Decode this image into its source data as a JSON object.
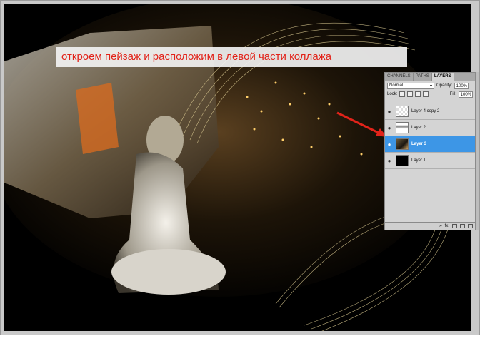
{
  "caption": "откроем пейзаж и расположим в левой части коллажа",
  "panel": {
    "tabs": [
      "CHANNELS",
      "PATHS",
      "LAYERS"
    ],
    "blend_mode": "Normal",
    "opacity_label": "Opacity:",
    "opacity_value": "100%",
    "lock_label": "Lock:",
    "fill_label": "Fill:",
    "fill_value": "100%",
    "layers": [
      {
        "name": "Layer 4 copy 2",
        "selected": false
      },
      {
        "name": "Layer 2",
        "selected": false
      },
      {
        "name": "Layer 3",
        "selected": true
      },
      {
        "name": "Layer 1",
        "selected": false
      }
    ],
    "bottom_fx": "fx."
  },
  "colors": {
    "caption_text": "#e2231a",
    "selected_layer": "#3d96e6",
    "arrow": "#e2231a"
  }
}
